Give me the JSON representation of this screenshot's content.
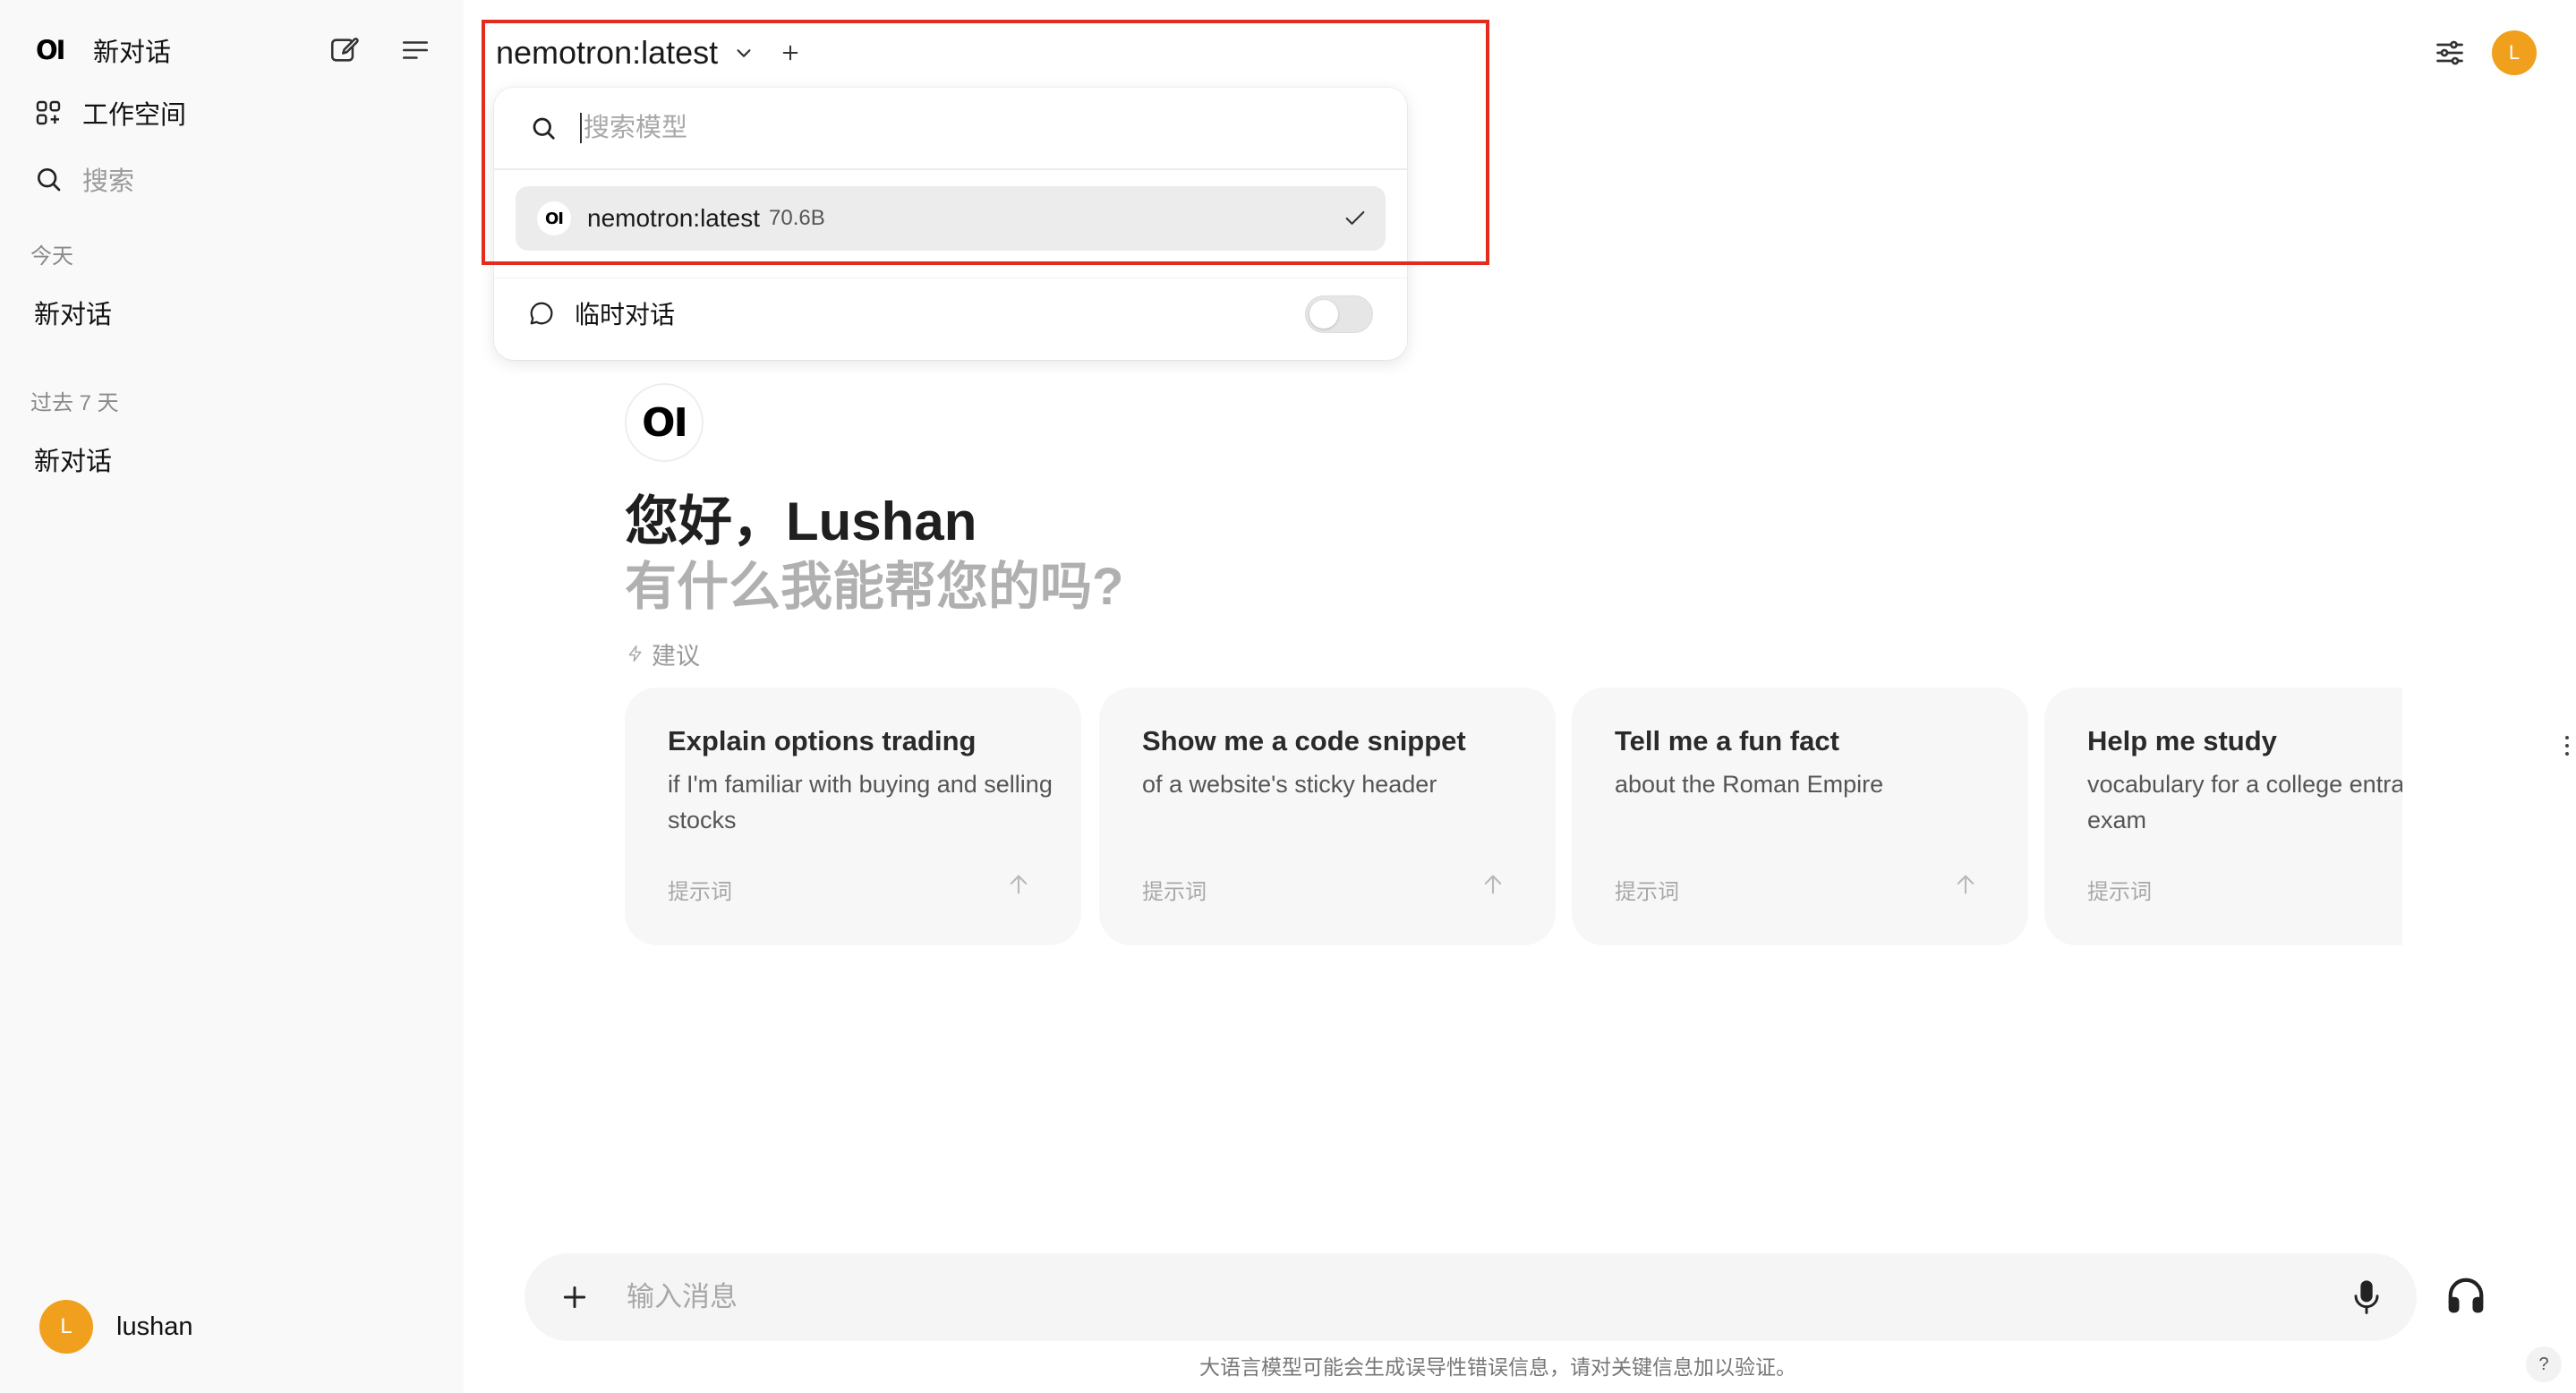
{
  "sidebar": {
    "brand_logo": "OI",
    "new_chat_label": "新对话",
    "workspace_label": "工作空间",
    "search_label": "搜索",
    "sections": [
      {
        "label": "今天",
        "chats": [
          "新对话"
        ]
      },
      {
        "label": "过去 7 天",
        "chats": [
          "新对话"
        ]
      }
    ],
    "user": {
      "initial": "L",
      "name": "lushan"
    }
  },
  "header": {
    "model_name": "nemotron:latest",
    "add_model_symbol": "+",
    "user_initial": "L"
  },
  "model_dropdown": {
    "search_placeholder": "搜索模型",
    "items": [
      {
        "logo": "OI",
        "name": "nemotron:latest",
        "size": "70.6B",
        "selected": true
      }
    ],
    "temporary_chat_label": "临时对话",
    "temporary_chat_enabled": false
  },
  "greeting": {
    "logo": "OI",
    "title": "您好，Lushan",
    "subtitle": "有什么我能帮您的吗?"
  },
  "suggestions": {
    "label": "建议",
    "prompt_label": "提示词",
    "cards": [
      {
        "title": "Explain options trading",
        "subtitle": "if I'm familiar with buying and selling stocks"
      },
      {
        "title": "Show me a code snippet",
        "subtitle": "of a website's sticky header"
      },
      {
        "title": "Tell me a fun fact",
        "subtitle": "about the Roman Empire"
      },
      {
        "title": "Help me study",
        "subtitle": "vocabulary for a college entrance exam"
      }
    ]
  },
  "composer": {
    "placeholder": "输入消息"
  },
  "footer": {
    "disclaimer": "大语言模型可能会生成误导性错误信息，请对关键信息加以验证。",
    "help_symbol": "?"
  },
  "colors": {
    "accent_avatar": "#f0a01c",
    "highlight_border": "#e42b1f"
  }
}
